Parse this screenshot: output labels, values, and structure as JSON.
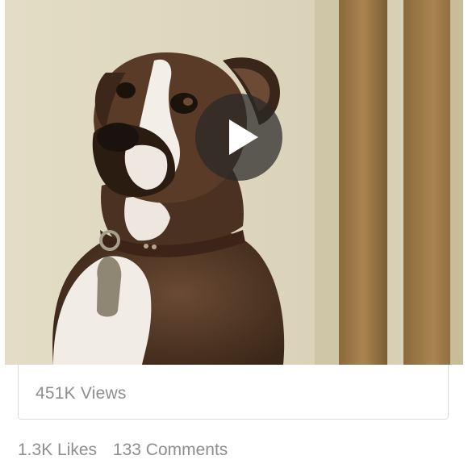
{
  "video": {
    "thumbnail_subject": "",
    "play_icon": "play-icon"
  },
  "views": {
    "label": "451K Views"
  },
  "stats": {
    "likes": "1.3K Likes",
    "comments": "133 Comments"
  },
  "colors": {
    "meta_text": "#8e8e8e",
    "card_border": "#dcdcdc",
    "play_overlay": "#282828"
  }
}
